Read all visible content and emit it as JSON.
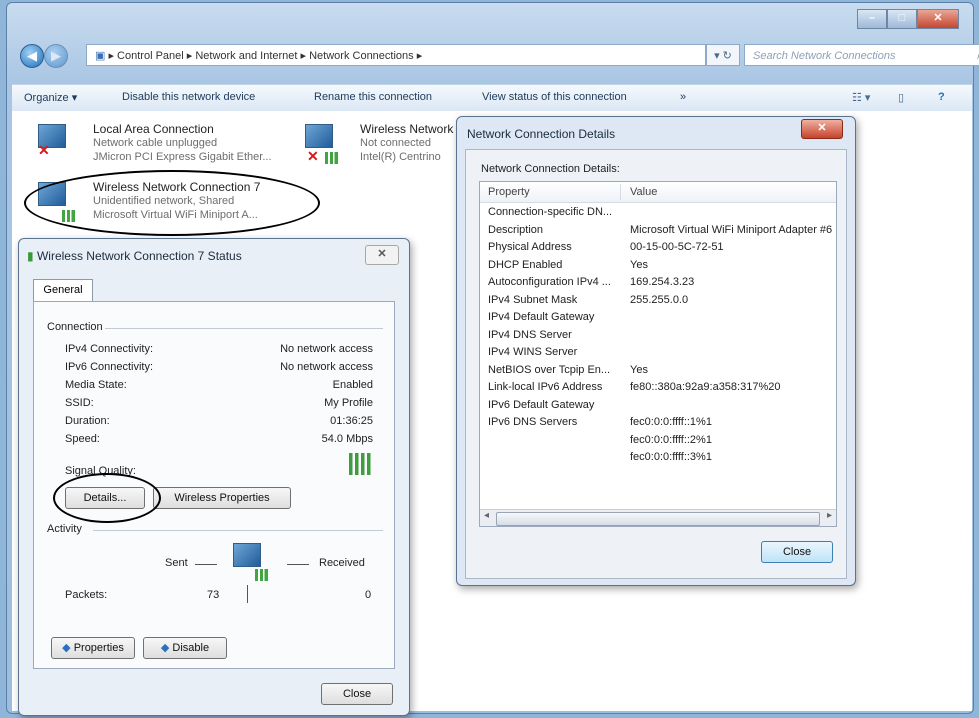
{
  "explorer": {
    "breadcrumb": [
      "Control Panel",
      "Network and Internet",
      "Network Connections"
    ],
    "search_placeholder": "Search Network Connections",
    "toolbar": {
      "organize": "Organize ▾",
      "disable": "Disable this network device",
      "rename": "Rename this connection",
      "view_status": "View status of this connection",
      "more": "»"
    },
    "connections": [
      {
        "name": "Local Area Connection",
        "line1": "Network cable unplugged",
        "line2": "JMicron PCI Express Gigabit Ether..."
      },
      {
        "name": "Wireless Network",
        "line1": "Not connected",
        "line2": "Intel(R) Centrino"
      },
      {
        "name": "Wireless Network Connection 7",
        "line1": "Unidentified network, Shared",
        "line2": "Microsoft Virtual WiFi Miniport A..."
      }
    ]
  },
  "status_dialog": {
    "title": "Wireless Network Connection 7 Status",
    "tab": "General",
    "connection_group": "Connection",
    "fields": [
      {
        "label": "IPv4 Connectivity:",
        "value": "No network access"
      },
      {
        "label": "IPv6 Connectivity:",
        "value": "No network access"
      },
      {
        "label": "Media State:",
        "value": "Enabled"
      },
      {
        "label": "SSID:",
        "value": "My Profile"
      },
      {
        "label": "Duration:",
        "value": "01:36:25"
      },
      {
        "label": "Speed:",
        "value": "54.0 Mbps"
      }
    ],
    "signal_quality": "Signal Quality:",
    "details_button": "Details...",
    "wireless_properties_button": "Wireless Properties",
    "activity_group": "Activity",
    "sent_label": "Sent",
    "received_label": "Received",
    "packets_label": "Packets:",
    "packets_sent": "73",
    "packets_received": "0",
    "properties_button": "Properties",
    "disable_button": "Disable",
    "close_button": "Close"
  },
  "details_dialog": {
    "title": "Network Connection Details",
    "caption": "Network Connection Details:",
    "col_property": "Property",
    "col_value": "Value",
    "rows": [
      {
        "p": "Connection-specific DN...",
        "v": ""
      },
      {
        "p": "Description",
        "v": "Microsoft Virtual WiFi Miniport Adapter #6"
      },
      {
        "p": "Physical Address",
        "v": "00-15-00-5C-72-51"
      },
      {
        "p": "DHCP Enabled",
        "v": "Yes"
      },
      {
        "p": "Autoconfiguration IPv4 ...",
        "v": "169.254.3.23"
      },
      {
        "p": "IPv4 Subnet Mask",
        "v": "255.255.0.0"
      },
      {
        "p": "IPv4 Default Gateway",
        "v": ""
      },
      {
        "p": "IPv4 DNS Server",
        "v": ""
      },
      {
        "p": "IPv4 WINS Server",
        "v": ""
      },
      {
        "p": "NetBIOS over Tcpip En...",
        "v": "Yes"
      },
      {
        "p": "Link-local IPv6 Address",
        "v": "fe80::380a:92a9:a358:317%20"
      },
      {
        "p": "IPv6 Default Gateway",
        "v": ""
      },
      {
        "p": "IPv6 DNS Servers",
        "v": "fec0:0:0:ffff::1%1"
      },
      {
        "p": "",
        "v": "fec0:0:0:ffff::2%1"
      },
      {
        "p": "",
        "v": "fec0:0:0:ffff::3%1"
      }
    ],
    "close_button": "Close"
  }
}
